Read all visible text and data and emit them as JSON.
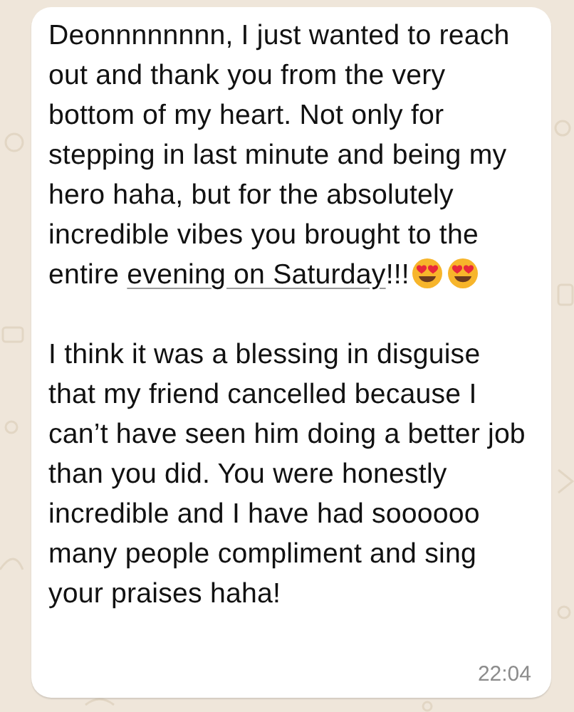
{
  "message": {
    "paragraphs": [
      {
        "text": "Deonnnnnnnn, I just wanted to reach out and thank you from the very bottom of my heart. Not only for stepping in last minute and being my hero haha, but for the absolutely incredible vibes you brought to the entire ",
        "link": "evening on Saturday",
        "after": "!!!",
        "emojis": [
          {
            "kind": "heart-eyes"
          },
          {
            "kind": "heart-eyes"
          }
        ]
      },
      {
        "text": "I think it was a blessing in disguise that my friend cancelled because I can’t have seen him doing a better job than you did. You were honestly incredible and I have had soooooo many people compliment and sing your praises haha!"
      }
    ],
    "time": "22:04"
  }
}
